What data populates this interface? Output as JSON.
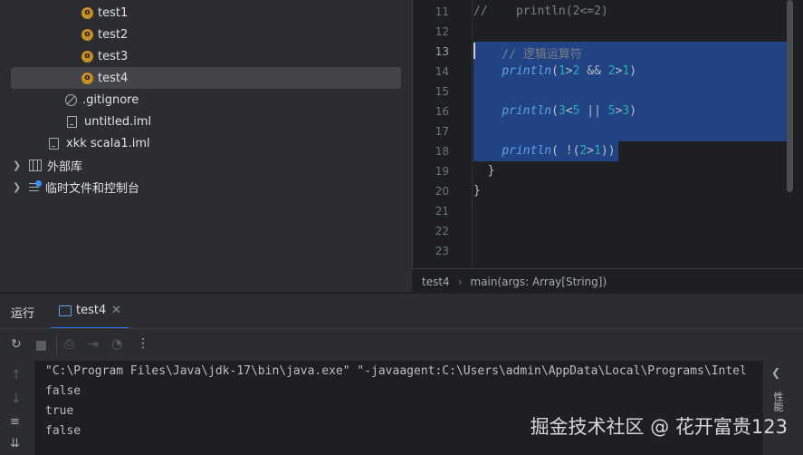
{
  "project_tree": {
    "items": [
      {
        "label": "test1",
        "type": "scala-object"
      },
      {
        "label": "test2",
        "type": "scala-object"
      },
      {
        "label": "test3",
        "type": "scala-object"
      },
      {
        "label": "test4",
        "type": "scala-object",
        "selected": true
      },
      {
        "label": ".gitignore",
        "type": "ignore-file"
      },
      {
        "label": "untitled.iml",
        "type": "module-file"
      },
      {
        "label": "xkk scala1.iml",
        "type": "module-file"
      },
      {
        "label": "外部库",
        "type": "external-libraries"
      },
      {
        "label": "临时文件和控制台",
        "type": "scratches"
      }
    ]
  },
  "editor": {
    "lines": [
      {
        "no": "11",
        "text": "//    println(2<=2)"
      },
      {
        "no": "12",
        "text": ""
      },
      {
        "no": "13",
        "text": "    // 逻辑运算符"
      },
      {
        "no": "14",
        "text": "    println(1>2 && 2>1)"
      },
      {
        "no": "15",
        "text": ""
      },
      {
        "no": "16",
        "text": "    println(3<5 || 5>3)"
      },
      {
        "no": "17",
        "text": ""
      },
      {
        "no": "18",
        "text": "    println( !(2>1))"
      },
      {
        "no": "19",
        "text": "  }"
      },
      {
        "no": "20",
        "text": "}"
      },
      {
        "no": "21",
        "text": ""
      },
      {
        "no": "22",
        "text": ""
      },
      {
        "no": "23",
        "text": ""
      }
    ],
    "current_line": "13"
  },
  "breadcrumb": {
    "items": [
      "test4",
      "main(args: Array[String])"
    ],
    "separator": "›"
  },
  "run_panel": {
    "title": "运行",
    "tab_label": "test4",
    "toolbar_icons": [
      "rerun-icon",
      "stop-icon",
      "screenshot-icon",
      "restore-layout-icon",
      "coverage-icon",
      "more-icon"
    ],
    "console_lines": [
      "\"C:\\Program Files\\Java\\jdk-17\\bin\\java.exe\" \"-javaagent:C:\\Users\\admin\\AppData\\Local\\Programs\\Intel",
      "false",
      "true",
      "false"
    ],
    "right_label": "性能"
  },
  "watermark": "掘金技术社区 @ 花开富贵123",
  "colors": {
    "selection": "#214283",
    "scala_icon": "#c69026",
    "number": "#2aacb8",
    "function": "#5ea2e8",
    "comment": "#7a7e85"
  }
}
